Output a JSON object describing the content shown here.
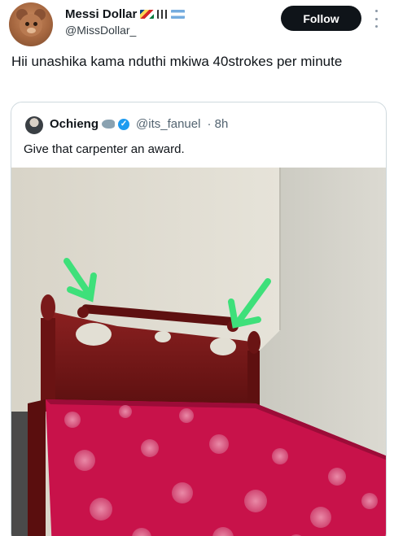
{
  "tweet": {
    "display_name": "Messi Dollar",
    "handle": "@MissDollar_",
    "follow_label": "Follow",
    "text": "Hii unashika kama nduthi mkiwa 40strokes per minute",
    "avatar_icon": "bear-avatar-icon",
    "name_badges": [
      "seychelles-flag-icon",
      "bars-icon",
      "argentina-flag-icon"
    ]
  },
  "quoted": {
    "display_name": "Ochieng",
    "handle": "@its_fanuel",
    "time": "· 8h",
    "text": "Give that carpenter an award.",
    "badges": [
      "shark-icon",
      "verified-icon"
    ]
  },
  "colors": {
    "follow_bg": "#0f1419",
    "verified": "#1d9bf0",
    "arrow": "#3ee07a",
    "bed_wood": "#6e1515",
    "mattress": "#c8124a"
  }
}
